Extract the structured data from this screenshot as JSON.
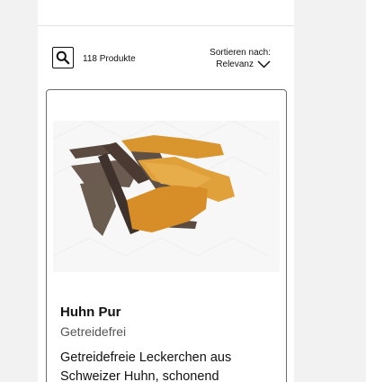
{
  "toolbar": {
    "search_icon": "search-icon",
    "product_count": "118 Produkte",
    "sort_label": "Sortieren nach:",
    "sort_value": "Relevanz",
    "sort_icon": "chevron-down-icon"
  },
  "product": {
    "title": "Huhn Pur",
    "subtitle": "Getreidefrei",
    "description": "Getreidefreie Leckerchen aus Schweizer Huhn, schonend"
  },
  "colors": {
    "page_background": "#f2f2f2",
    "card_border": "#6d6d6d",
    "subtitle": "#555555"
  }
}
